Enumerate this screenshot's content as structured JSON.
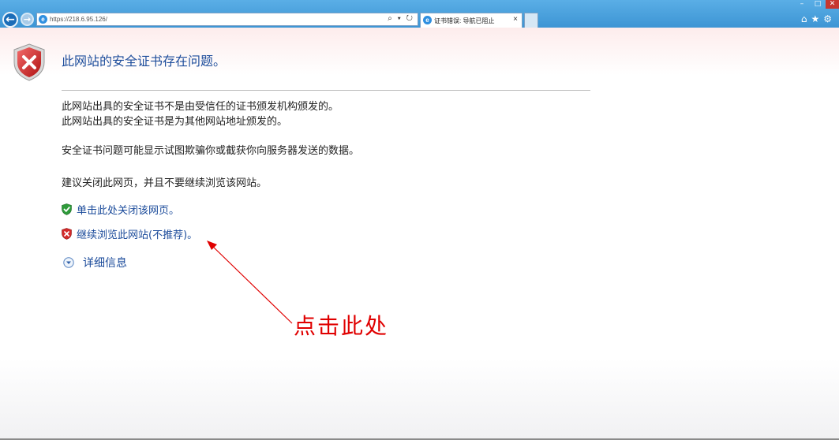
{
  "browser": {
    "url": "https://218.6.95.126/",
    "address_tools": "⌕ ▾ ↻",
    "tab_title": "证书错误: 导航已阻止",
    "tab_close": "×",
    "window_controls": {
      "minimize": "–",
      "maximize": "□",
      "close": "✕"
    },
    "toolbar_icons": [
      "home-icon",
      "favorites-star-icon",
      "gear-icon"
    ],
    "toolbar_glyphs": "⌂★⚙"
  },
  "page": {
    "title": "此网站的安全证书存在问题。",
    "reasons": [
      "此网站出具的安全证书不是由受信任的证书颁发机构颁发的。",
      "此网站出具的安全证书是为其他网站地址颁发的。"
    ],
    "warning": "安全证书问题可能显示试图欺骗你或截获你向服务器发送的数据。",
    "recommendation": "建议关闭此网页，并且不要继续浏览该网站。",
    "close_link": "单击此处关闭该网页。",
    "continue_link": "继续浏览此网站(不推荐)。",
    "details_link": "详细信息"
  },
  "annotation": {
    "text": "点击此处",
    "color": "#e00000"
  },
  "colors": {
    "chrome_blue": "#3d95d4",
    "title_blue": "#1f4e9c",
    "link_blue": "#1a4a9a",
    "error_red": "#d42a2a",
    "ok_green": "#2e9b3a"
  }
}
